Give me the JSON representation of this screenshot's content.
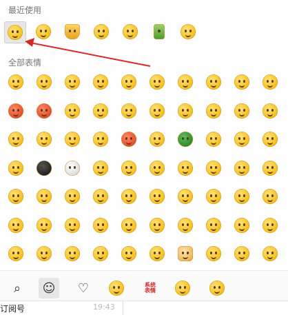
{
  "recent": {
    "title": "最近使用",
    "items": [
      {
        "name": "emoji-laugh-cry",
        "variant": ""
      },
      {
        "name": "emoji-smirk",
        "variant": ""
      },
      {
        "name": "emoji-pray",
        "variant": "hands"
      },
      {
        "name": "emoji-cry",
        "variant": ""
      },
      {
        "name": "emoji-facepalm",
        "variant": ""
      },
      {
        "name": "emoji-thumbs-up",
        "variant": "thumb"
      },
      {
        "name": "emoji-frown",
        "variant": ""
      }
    ]
  },
  "all": {
    "title": "全部表情",
    "rows": [
      [
        "",
        "",
        "",
        "",
        "",
        "",
        "",
        "",
        "",
        ""
      ],
      [
        "red",
        "red",
        "",
        "",
        "",
        "",
        "",
        "",
        "",
        ""
      ],
      [
        "",
        "",
        "",
        "",
        "red",
        "",
        "green",
        "",
        "",
        ""
      ],
      [
        "",
        "dark",
        "skull",
        "",
        "",
        "",
        "",
        "",
        "",
        ""
      ],
      [
        "",
        "",
        "",
        "",
        "",
        "",
        "",
        "",
        "",
        ""
      ],
      [
        "",
        "",
        "",
        "",
        "",
        "",
        "",
        "",
        "",
        ""
      ],
      [
        "",
        "",
        "",
        "",
        "",
        "",
        "dog",
        "",
        "",
        ""
      ]
    ]
  },
  "toolbar": {
    "items": [
      {
        "name": "search-icon",
        "glyph": "⌕"
      },
      {
        "name": "smiley-tab-icon",
        "glyph": "☺"
      },
      {
        "name": "favorites-heart-icon",
        "glyph": "♡"
      },
      {
        "name": "sticker-pack-icon",
        "glyph": ""
      },
      {
        "name": "sticker-text-pack-icon",
        "glyph": ""
      },
      {
        "name": "sticker-pack-2-icon",
        "glyph": ""
      },
      {
        "name": "sticker-pack-3-icon",
        "glyph": ""
      }
    ],
    "sticker_text": "系统\n表情"
  },
  "footer": {
    "left_text": "订阅号",
    "time": "19:43"
  },
  "accent_color": "#d62a2a"
}
